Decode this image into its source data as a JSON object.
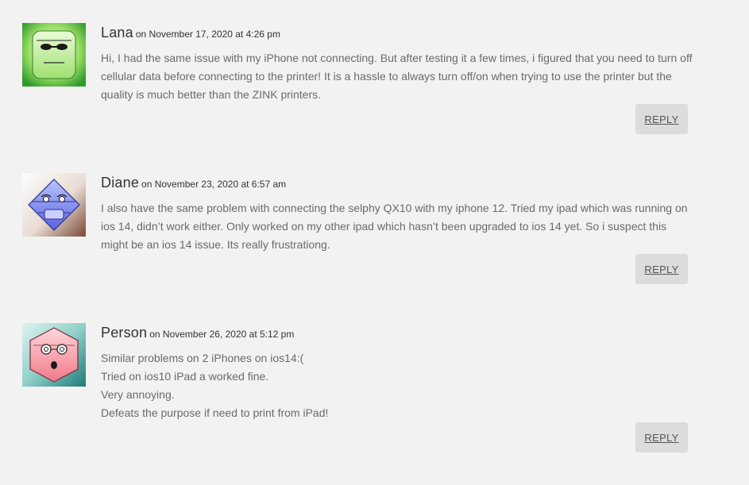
{
  "comments": [
    {
      "author": "Lana",
      "date": "on November 17, 2020 at 4:26 pm",
      "lines": [
        "Hi, I had the same issue with my iPhone not connecting. But after testing it a few times, i figured that you need to turn off cellular data before connecting to the printer! It is a hassle to always turn off/on when trying to use the printer but the quality is much better than the ZINK printers."
      ],
      "reply_label": "REPLY",
      "avatar_icon": "green-square-face-with-sunglasses-icon"
    },
    {
      "author": "Diane",
      "date": "on November 23, 2020 at 6:57 am",
      "lines": [
        "I also have the same problem with connecting the selphy QX10 with my iphone 12. Tried my ipad which was running on ios 14, didn’t work either. Only worked on my other ipad which hasn’t been upgraded to ios 14 yet. So i suspect this might be an ios 14 issue. Its really frustrationg."
      ],
      "reply_label": "REPLY",
      "avatar_icon": "blue-diamond-face-icon"
    },
    {
      "author": "Person",
      "date": "on November 26, 2020 at 5:12 pm",
      "lines": [
        "Similar problems on 2 iPhones on ios14:(",
        "Tried on ios10 iPad a worked fine.",
        "Very annoying.",
        "Defeats the purpose if need to print from iPad!"
      ],
      "reply_label": "REPLY",
      "avatar_icon": "pink-hexagon-face-with-glasses-icon"
    }
  ],
  "colors": {
    "background": "#f2f2f2",
    "author_text": "#333333",
    "body_text": "#6a6a6a",
    "reply_button": "#dcdcdc"
  }
}
